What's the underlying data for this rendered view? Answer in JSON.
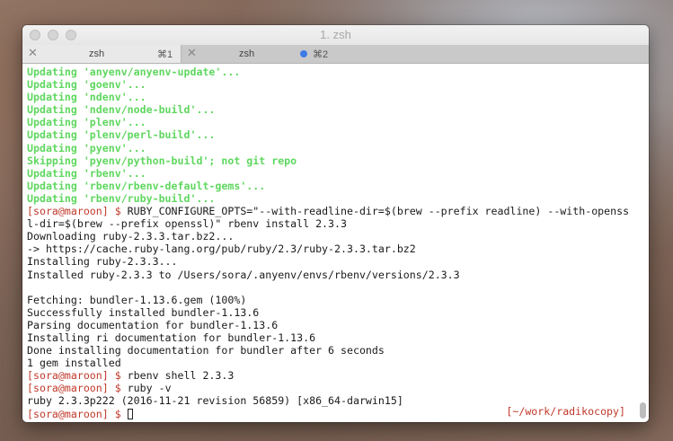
{
  "window": {
    "title": "1. zsh"
  },
  "tabs": [
    {
      "label": "zsh",
      "shortcut": "⌘1",
      "active": true
    },
    {
      "label": "zsh",
      "shortcut": "⌘2",
      "active": false,
      "activity": true
    }
  ],
  "terminal": {
    "lines": [
      {
        "type": "green",
        "text": "Updating 'anyenv/anyenv-update'..."
      },
      {
        "type": "green",
        "text": "Updating 'goenv'..."
      },
      {
        "type": "green",
        "text": "Updating 'ndenv'..."
      },
      {
        "type": "green",
        "text": "Updating 'ndenv/node-build'..."
      },
      {
        "type": "green",
        "text": "Updating 'plenv'..."
      },
      {
        "type": "green",
        "text": "Updating 'plenv/perl-build'..."
      },
      {
        "type": "green",
        "text": "Updating 'pyenv'..."
      },
      {
        "type": "green",
        "text": "Skipping 'pyenv/python-build'; not git repo"
      },
      {
        "type": "green",
        "text": "Updating 'rbenv'..."
      },
      {
        "type": "green",
        "text": "Updating 'rbenv/rbenv-default-gems'..."
      },
      {
        "type": "green",
        "text": "Updating 'rbenv/ruby-build'..."
      },
      {
        "type": "prompt",
        "prompt": "[sora@maroon] $",
        "text": " RUBY_CONFIGURE_OPTS=\"--with-readline-dir=$(brew --prefix readline) --with-openss"
      },
      {
        "type": "plain",
        "text": "l-dir=$(brew --prefix openssl)\" rbenv install 2.3.3"
      },
      {
        "type": "plain",
        "text": "Downloading ruby-2.3.3.tar.bz2..."
      },
      {
        "type": "plain",
        "text": "-> https://cache.ruby-lang.org/pub/ruby/2.3/ruby-2.3.3.tar.bz2"
      },
      {
        "type": "plain",
        "text": "Installing ruby-2.3.3..."
      },
      {
        "type": "plain",
        "text": "Installed ruby-2.3.3 to /Users/sora/.anyenv/envs/rbenv/versions/2.3.3"
      },
      {
        "type": "plain",
        "text": ""
      },
      {
        "type": "plain",
        "text": "Fetching: bundler-1.13.6.gem (100%)"
      },
      {
        "type": "plain",
        "text": "Successfully installed bundler-1.13.6"
      },
      {
        "type": "plain",
        "text": "Parsing documentation for bundler-1.13.6"
      },
      {
        "type": "plain",
        "text": "Installing ri documentation for bundler-1.13.6"
      },
      {
        "type": "plain",
        "text": "Done installing documentation for bundler after 6 seconds"
      },
      {
        "type": "plain",
        "text": "1 gem installed"
      },
      {
        "type": "prompt",
        "prompt": "[sora@maroon] $",
        "text": " rbenv shell 2.3.3"
      },
      {
        "type": "prompt",
        "prompt": "[sora@maroon] $",
        "text": " ruby -v"
      },
      {
        "type": "plain",
        "text": "ruby 2.3.3p222 (2016-11-21 revision 56859) [x86_64-darwin15]"
      },
      {
        "type": "prompt-cursor",
        "prompt": "[sora@maroon] $",
        "text": " "
      }
    ],
    "right_prompt": "[~/work/radikocopy]"
  }
}
